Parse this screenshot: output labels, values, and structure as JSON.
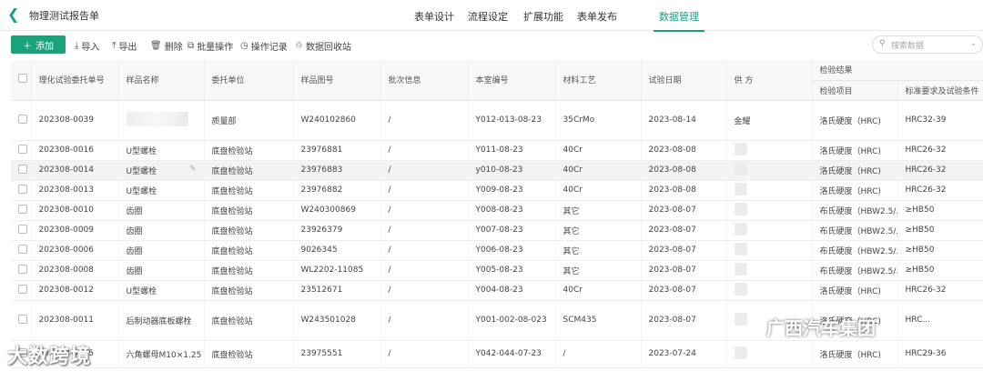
{
  "header": {
    "title": "物理测试报告单",
    "nav": [
      "表单设计",
      "流程设定",
      "扩展功能",
      "表单发布",
      "数据管理"
    ],
    "active_nav": "数据管理"
  },
  "toolbar": {
    "add": "添加",
    "import": "导入",
    "export": "导出",
    "delete": "删除",
    "batch": "批量操作",
    "log": "操作记录",
    "recycle": "数据回收站",
    "search_placeholder": "搜索数据"
  },
  "table": {
    "headers": {
      "id": "理化试验委托单号",
      "sample": "样品名称",
      "unit": "委托单位",
      "drawing": "样品图号",
      "batch": "批次信息",
      "code": "本室编号",
      "material": "材料工艺",
      "date": "试验日期",
      "supplier": "供 方",
      "result_group": "检验结果",
      "item": "检验项目",
      "standard": "标准要求及试验条件"
    },
    "rows": [
      {
        "id": "202308-0039",
        "sample": "",
        "unit": "质量部",
        "drawing": "W240102860",
        "batch": "/",
        "code": "Y012-013-08-23",
        "material": "35CrMo",
        "date": "2023-08-14",
        "supplier": "金耀",
        "item": "洛氏硬度（HRC)",
        "standard": "HRC32-39"
      },
      {
        "id": "202308-0016",
        "sample": "U型螺栓",
        "unit": "底盘检验站",
        "drawing": "23976881",
        "batch": "/",
        "code": "Y011-08-23",
        "material": "40Cr",
        "date": "2023-08-08",
        "supplier": "",
        "item": "洛氏硬度（HRC)",
        "standard": "HRC26-32"
      },
      {
        "id": "202308-0014",
        "sample": "U型螺栓",
        "unit": "底盘检验站",
        "drawing": "23976883",
        "batch": "/",
        "code": "y010-08-23",
        "material": "40Cr",
        "date": "2023-08-08",
        "supplier": "",
        "item": "洛氏硬度（HRC)",
        "standard": "HRC26-32"
      },
      {
        "id": "202308-0013",
        "sample": "U型螺栓",
        "unit": "底盘检验站",
        "drawing": "23976882",
        "batch": "/",
        "code": "Y009-08-23",
        "material": "40Cr",
        "date": "2023-08-08",
        "supplier": "",
        "item": "洛氏硬度（HRC)",
        "standard": "HRC26-32"
      },
      {
        "id": "202308-0010",
        "sample": "齿圈",
        "unit": "底盘检验站",
        "drawing": "W240300869",
        "batch": "/",
        "code": "Y008-08-23",
        "material": "其它",
        "date": "2023-08-07",
        "supplier": "",
        "item": "布氏硬度（HBW2.5/...",
        "standard": "≥HB50"
      },
      {
        "id": "202308-0009",
        "sample": "齿圈",
        "unit": "底盘检验站",
        "drawing": "23926379",
        "batch": "/",
        "code": "Y007-08-23",
        "material": "其它",
        "date": "2023-08-07",
        "supplier": "",
        "item": "布氏硬度（HBW2.5/...",
        "standard": "≥HB50"
      },
      {
        "id": "202308-0006",
        "sample": "齿圈",
        "unit": "底盘检验站",
        "drawing": "9026345",
        "batch": "/",
        "code": "Y006-08-23",
        "material": "其它",
        "date": "2023-08-07",
        "supplier": "",
        "item": "布氏硬度（HBW2.5/...",
        "standard": "≥HB50"
      },
      {
        "id": "202308-0008",
        "sample": "齿圈",
        "unit": "底盘检验站",
        "drawing": "WL2202-11085",
        "batch": "/",
        "code": "Y005-08-23",
        "material": "其它",
        "date": "2023-08-07",
        "supplier": "",
        "item": "布氏硬度（HBW2.5/...",
        "standard": "≥HB50"
      },
      {
        "id": "202308-0012",
        "sample": "U型螺栓",
        "unit": "底盘检验站",
        "drawing": "23512671",
        "batch": "/",
        "code": "Y004-08-23",
        "material": "40Cr",
        "date": "2023-08-07",
        "supplier": "",
        "item": "洛氏硬度（HRC)",
        "standard": "HRC26-32"
      },
      {
        "id": "202308-0011",
        "sample": "后制动器底板螺栓",
        "unit": "底盘检验站",
        "drawing": "W243501028",
        "batch": "/",
        "code": "Y001-002-08-023",
        "material": "SCM435",
        "date": "2023-08-07",
        "supplier": "",
        "item": "洛氏硬度（HRC)",
        "standard": "HRC..."
      },
      {
        "id": "202308-0005",
        "sample": "六角螺母M10×1.25",
        "unit": "底盘检验站",
        "drawing": "23975551",
        "batch": "/",
        "code": "Y042-044-07-23",
        "material": "/",
        "date": "2023-07-24",
        "supplier": "",
        "item": "洛氏硬度（HRC)",
        "standard": "HRC29-36"
      }
    ]
  },
  "watermarks": {
    "left": "大数跨境",
    "right": "广西汽车集团"
  }
}
